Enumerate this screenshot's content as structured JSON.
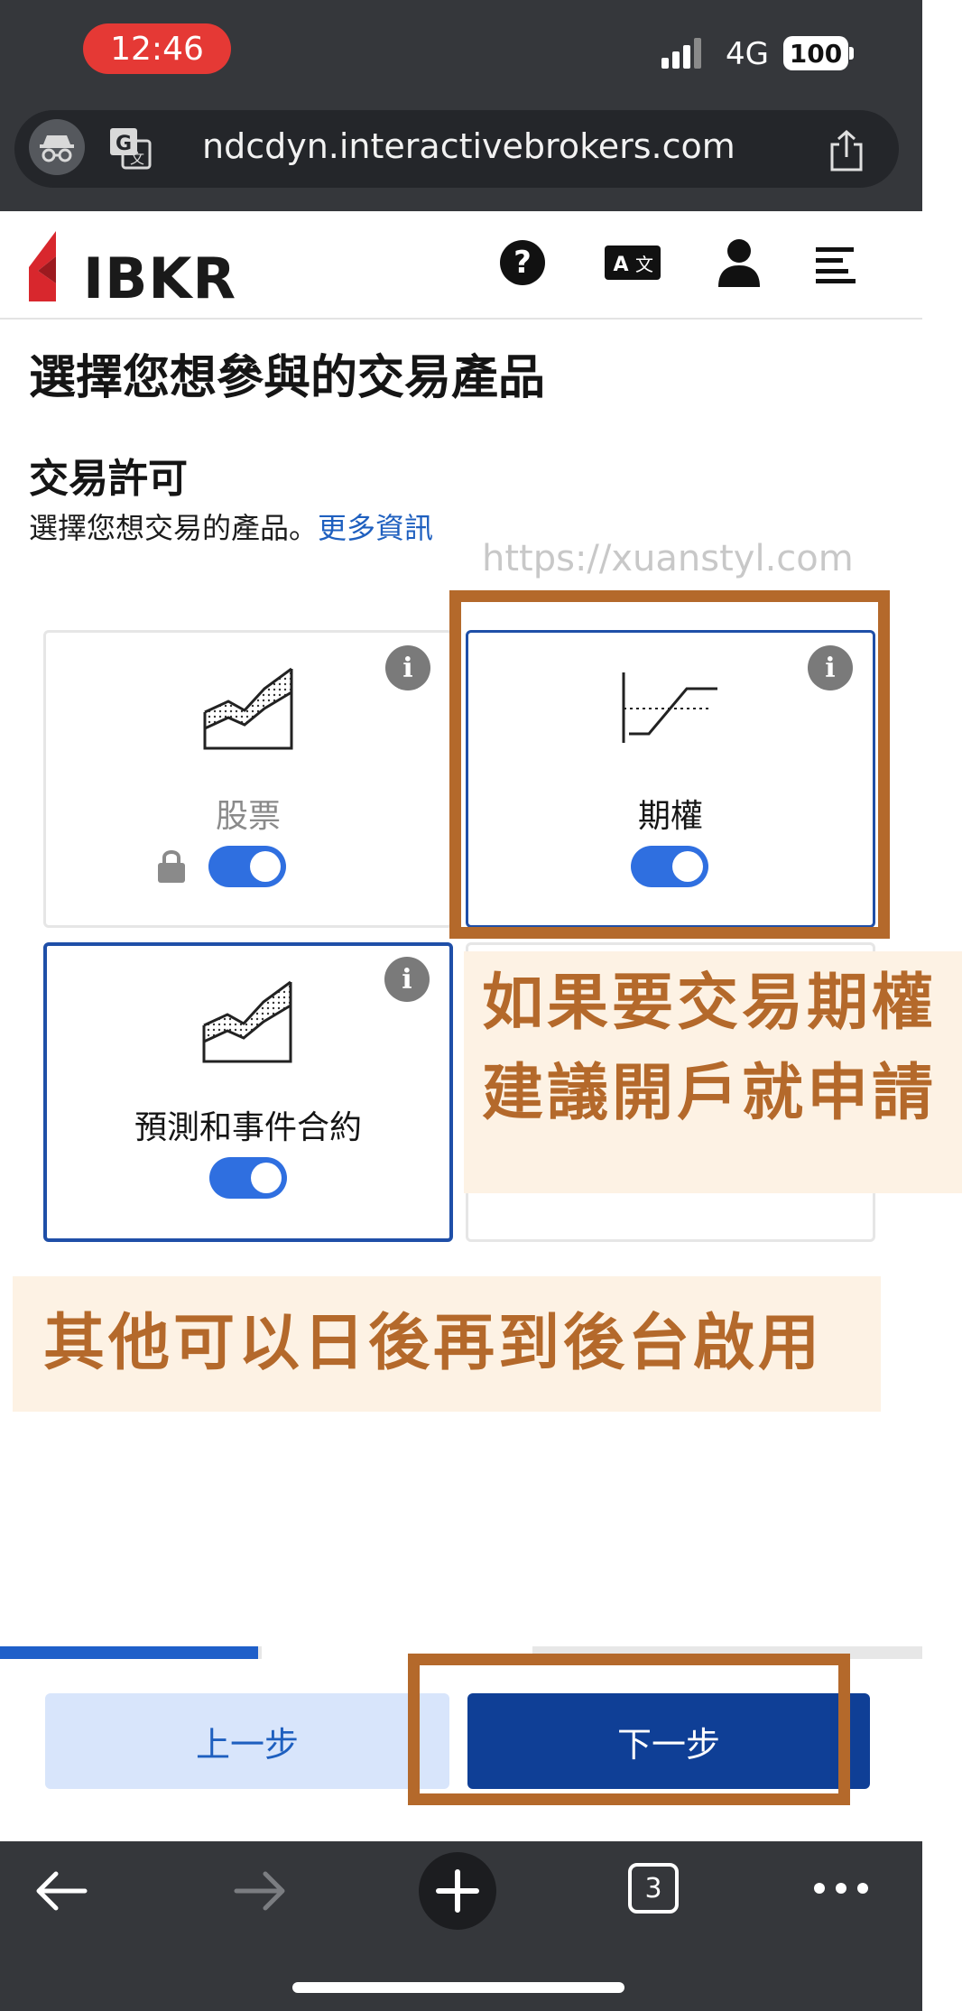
{
  "status_bar": {
    "time": "12:46",
    "network": "4G",
    "battery": "100"
  },
  "browser": {
    "url": "ndcdyn.interactivebrokers.com",
    "tab_count": "3"
  },
  "site": {
    "logo_text": "IBKR"
  },
  "header_icons": [
    "help-icon",
    "language-icon",
    "user-icon",
    "menu-icon"
  ],
  "page": {
    "title": "選擇您想參與的交易產品",
    "section_title": "交易許可",
    "description": "選擇您想交易的產品。",
    "more_info_link": "更多資訊"
  },
  "watermark": "https://xuanstyl.com",
  "products": [
    {
      "label": "股票",
      "enabled": true,
      "locked": true
    },
    {
      "label": "期權",
      "enabled": true,
      "locked": false
    },
    {
      "label": "預測和事件合約",
      "enabled": true,
      "locked": false
    }
  ],
  "annotations": {
    "note1_line1": "如果要交易期權",
    "note1_line2": "建議開戶就申請",
    "note2": "其他可以日後再到後台啟用"
  },
  "footer": {
    "prev_label": "上一步",
    "next_label": "下一步",
    "progress": 0.28
  },
  "colors": {
    "accent": "#1f5fc9",
    "primary_button": "#0f3f96",
    "annotation": "#b4692b",
    "brand_red": "#d8272d"
  }
}
